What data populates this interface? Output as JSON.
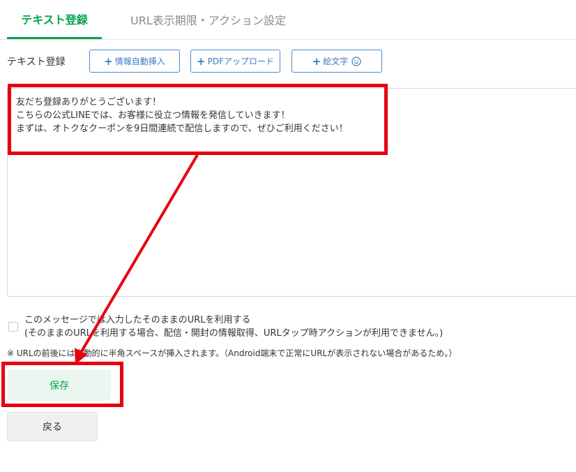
{
  "tabs": [
    {
      "label": "テキスト登録",
      "active": true
    },
    {
      "label": "URL表示期限・アクション設定",
      "active": false
    }
  ],
  "section_label": "テキスト登録",
  "toolbar": {
    "insert_label": "情報自動挿入",
    "pdf_label": "PDFアップロード",
    "emoji_label": "絵文字",
    "plus": "+"
  },
  "editor": {
    "lines": [
      "友だち登録ありがとうございます！",
      "こちらの公式LINEでは、お客様に役立つ情報を発信していきます！",
      "まずは、オトクなクーポンを9日間連続で配信しますので、ぜひご利用ください！"
    ]
  },
  "url_option": {
    "label": "このメッセージでは入力したそのままのURLを利用する",
    "sublabel": "(そのままのURLを利用する場合、配信・開封の情報取得、URLタップ時アクションが利用できません。)",
    "checked": false
  },
  "note": "※ URLの前後には自動的に半角スペースが挿入されます。（Android端末で正常にURLが表示されない場合があるため。）",
  "buttons": {
    "save_label": "保存",
    "back_label": "戻る"
  },
  "colors": {
    "accent_green": "#06a450",
    "button_blue": "#3a7cc4",
    "annotation_red": "#e60012"
  }
}
